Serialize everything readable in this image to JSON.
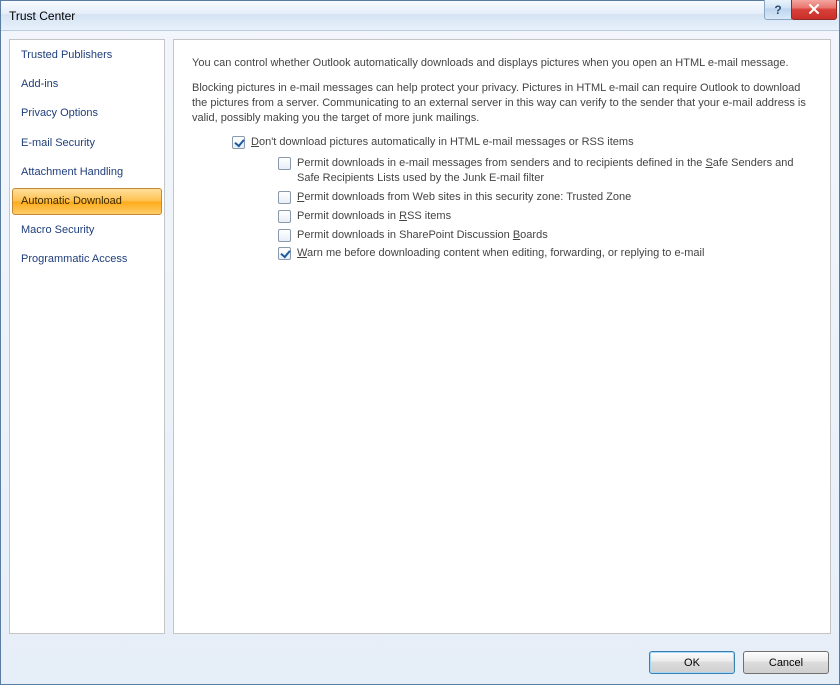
{
  "window": {
    "title": "Trust Center"
  },
  "sidebar": {
    "items": [
      {
        "label": "Trusted Publishers"
      },
      {
        "label": "Add-ins"
      },
      {
        "label": "Privacy Options"
      },
      {
        "label": "E-mail Security"
      },
      {
        "label": "Attachment Handling"
      },
      {
        "label": "Automatic Download"
      },
      {
        "label": "Macro Security"
      },
      {
        "label": "Programmatic Access"
      }
    ]
  },
  "main": {
    "intro1": "You can control whether Outlook automatically downloads and displays pictures when you open an HTML e-mail message.",
    "intro2": "Blocking pictures in e-mail messages can help protect your privacy. Pictures in HTML e-mail can require Outlook to download the pictures from a server. Communicating to an external server in this way can verify to the sender that your e-mail address is valid, possibly making you the target of more junk mailings.",
    "opt_main": {
      "checked": true,
      "pre": "",
      "u": "D",
      "post": "on't download pictures automatically in HTML e-mail messages or RSS items"
    },
    "subs": [
      {
        "checked": false,
        "pre": "Permit downloads in e-mail messages from senders and to recipients defined in the ",
        "u": "S",
        "post": "afe Senders and Safe Recipients Lists used by the Junk E-mail filter"
      },
      {
        "checked": false,
        "pre": "",
        "u": "P",
        "post": "ermit downloads from Web sites in this security zone: Trusted Zone"
      },
      {
        "checked": false,
        "pre": "Permit downloads in ",
        "u": "R",
        "post": "SS items"
      },
      {
        "checked": false,
        "pre": "Permit downloads in SharePoint Discussion ",
        "u": "B",
        "post": "oards"
      },
      {
        "checked": true,
        "pre": "",
        "u": "W",
        "post": "arn me before downloading content when editing, forwarding, or replying to e-mail"
      }
    ]
  },
  "buttons": {
    "ok": "OK",
    "cancel": "Cancel"
  }
}
